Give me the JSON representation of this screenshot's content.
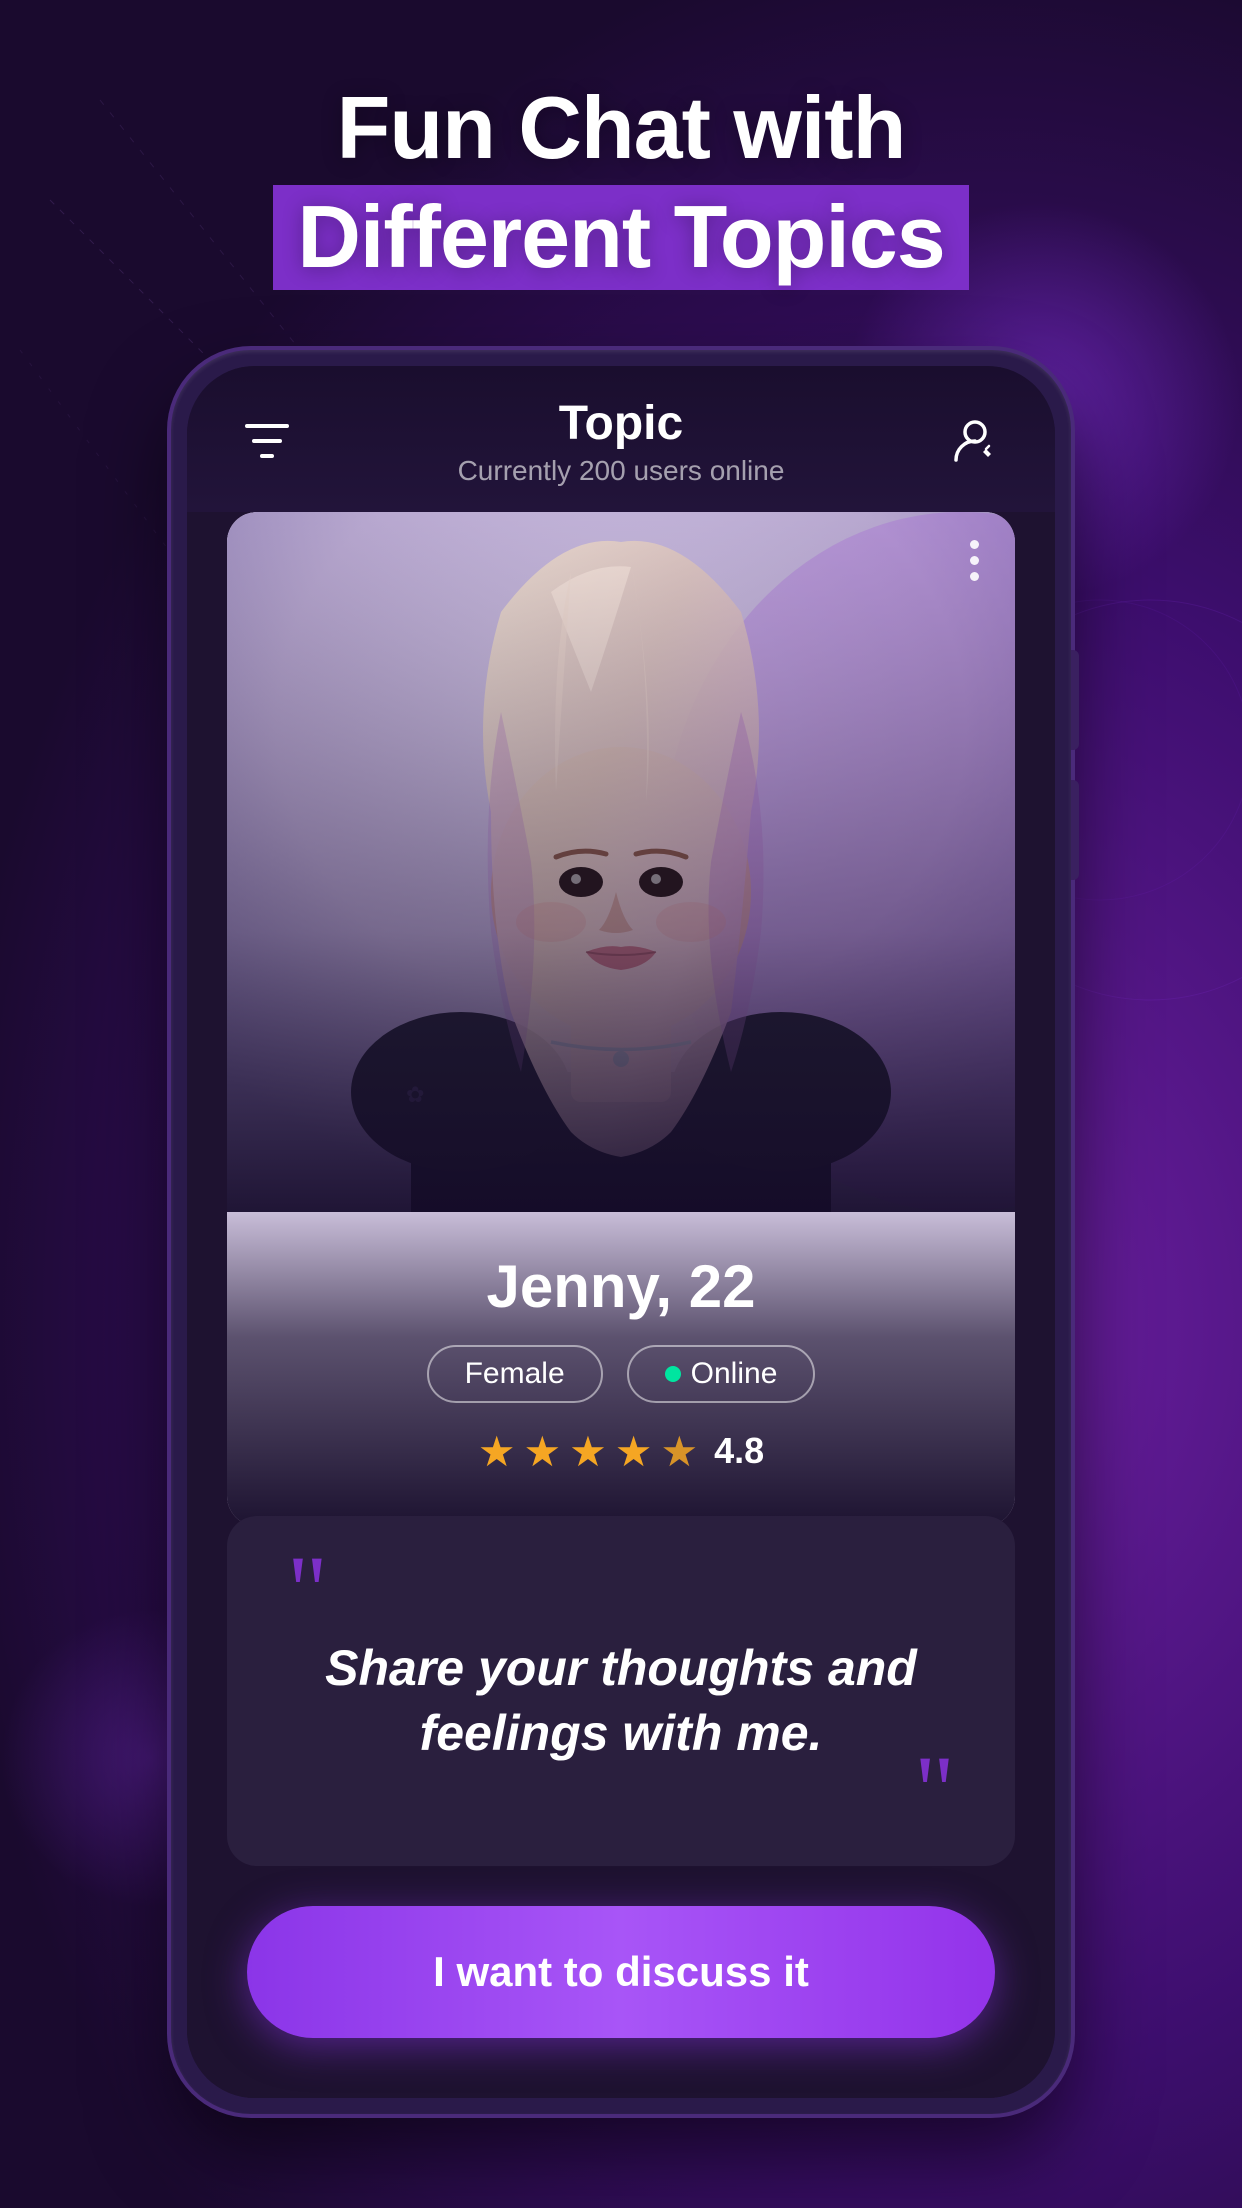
{
  "background": {
    "color": "#1a0a2e"
  },
  "headline": {
    "line1": "Fun Chat with",
    "line2": "Different Topics"
  },
  "app_header": {
    "title": "Topic",
    "subtitle": "Currently 200 users online",
    "filter_icon": "filter-icon",
    "profile_edit_icon": "profile-edit-icon"
  },
  "profile_card": {
    "name": "Jenny, 22",
    "gender": "Female",
    "status": "Online",
    "rating": "4.8",
    "stars_filled": 4,
    "stars_half": 1,
    "more_options_icon": "more-options-icon"
  },
  "quote": {
    "text": "Share your thoughts and feelings with me.",
    "open_mark": "“",
    "close_mark": "”"
  },
  "cta_button": {
    "label": "I want to discuss it"
  }
}
